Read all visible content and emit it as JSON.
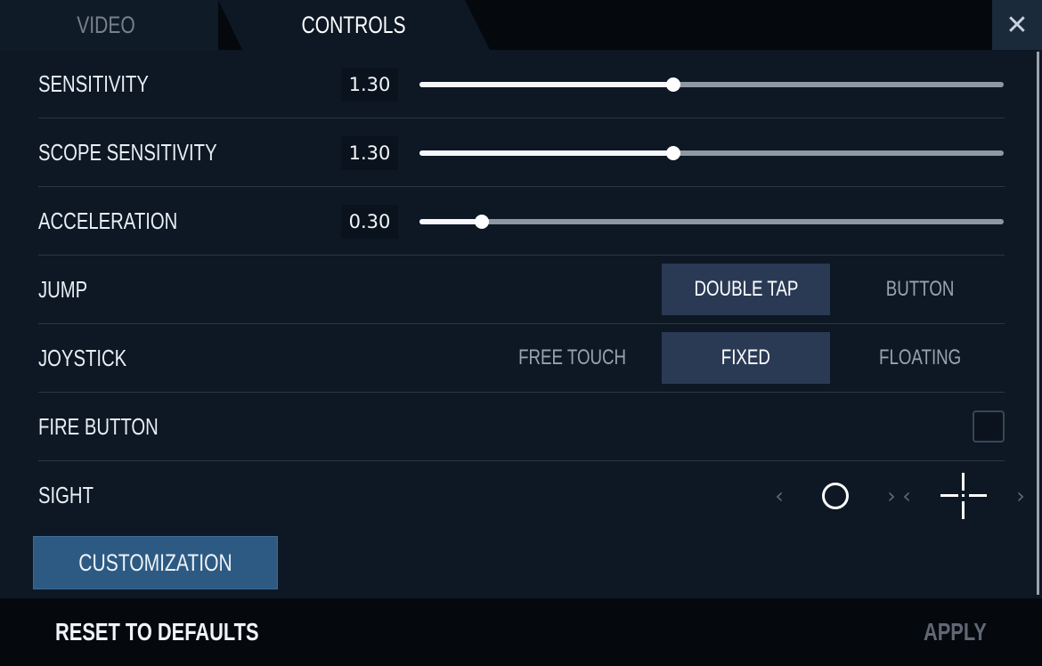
{
  "tabs": [
    {
      "label": "VIDEO",
      "active": false
    },
    {
      "label": "CONTROLS",
      "active": true
    }
  ],
  "close_icon": "close-icon",
  "settings": {
    "sensitivity": {
      "label": "SENSITIVITY",
      "value": "1.30",
      "fraction": 0.435
    },
    "scope_sensitivity": {
      "label": "SCOPE SENSITIVITY",
      "value": "1.30",
      "fraction": 0.435
    },
    "acceleration": {
      "label": "ACCELERATION",
      "value": "0.30",
      "fraction": 0.107
    },
    "jump": {
      "label": "JUMP",
      "options": [
        "DOUBLE TAP",
        "BUTTON"
      ],
      "selected": "DOUBLE TAP"
    },
    "joystick": {
      "label": "JOYSTICK",
      "options": [
        "FREE TOUCH",
        "FIXED",
        "FLOATING"
      ],
      "selected": "FIXED"
    },
    "fire_button": {
      "label": "FIRE BUTTON",
      "checked": false
    },
    "sight": {
      "label": "SIGHT",
      "sight_one": "circle",
      "sight_two": "crosshair"
    }
  },
  "customization_label": "CUSTOMIZATION",
  "footer": {
    "reset_label": "RESET TO DEFAULTS",
    "apply_label": "APPLY"
  },
  "colors": {
    "accent": "#2d5a82",
    "segment_active": "#2a3a55",
    "background": "#0d1824"
  }
}
